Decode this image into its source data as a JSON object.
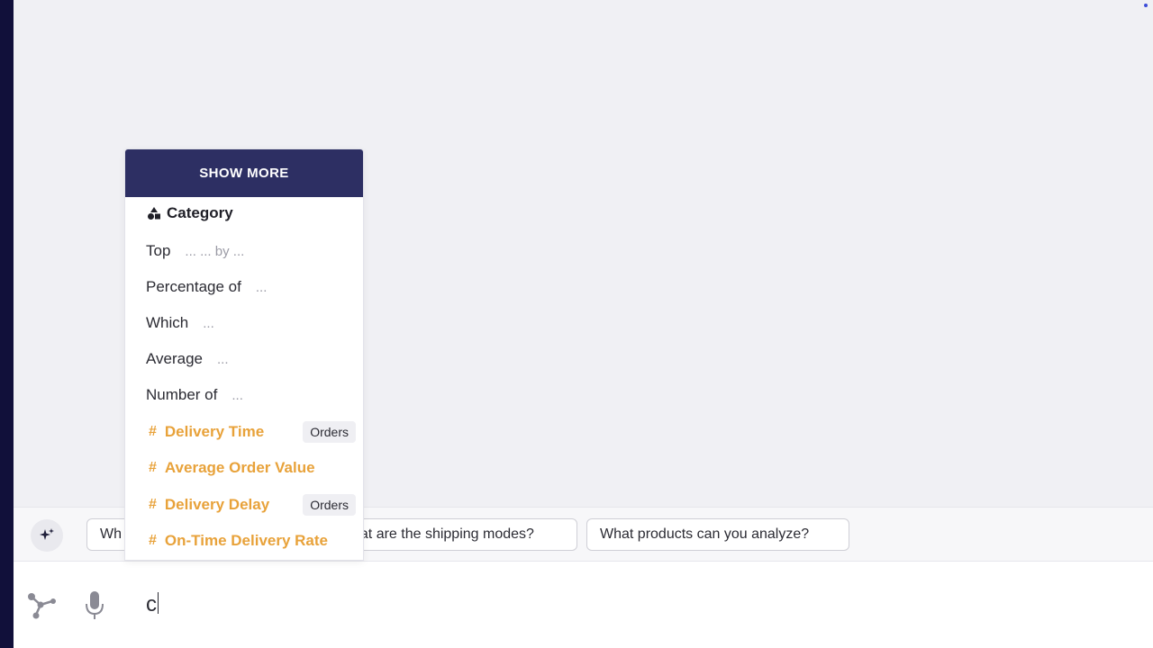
{
  "dropdown": {
    "show_more_label": "SHOW MORE",
    "category_heading": "Category",
    "templates": [
      {
        "label": "Top",
        "hint": "... ... by ..."
      },
      {
        "label": "Percentage of",
        "hint": "..."
      },
      {
        "label": "Which",
        "hint": "..."
      },
      {
        "label": "Average",
        "hint": "..."
      },
      {
        "label": "Number of",
        "hint": "..."
      }
    ],
    "fields": [
      {
        "symbol": "#",
        "label": "Delivery Time",
        "tag": "Orders"
      },
      {
        "symbol": "#",
        "label": "Average Order Value",
        "tag": ""
      },
      {
        "symbol": "#",
        "label": "Delivery Delay",
        "tag": "Orders"
      },
      {
        "symbol": "#",
        "label": "On-Time Delivery Rate",
        "tag": ""
      }
    ],
    "field_color": "#e8a23a"
  },
  "suggestions": {
    "chips": [
      {
        "label": "Wh"
      },
      {
        "label": "nat are the shipping modes?"
      },
      {
        "label": "What products can you analyze?"
      }
    ]
  },
  "input": {
    "value": "c"
  },
  "icons": {
    "sparkle": "sparkle-icon",
    "graph": "graph-icon",
    "mic": "microphone-icon",
    "category": "shapes-icon"
  },
  "colors": {
    "accent": "#2d2f63",
    "left_strip": "#11103a"
  }
}
